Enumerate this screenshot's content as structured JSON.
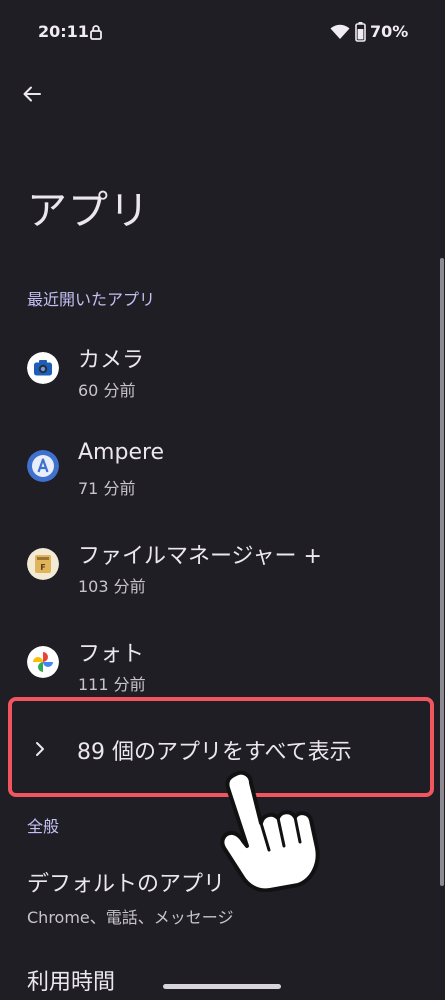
{
  "status_bar": {
    "time": "20:11",
    "battery": "70%"
  },
  "page": {
    "title": "アプリ"
  },
  "recent": {
    "header": "最近開いたアプリ",
    "apps": [
      {
        "name": "カメラ",
        "time": "60 分前",
        "icon": "camera-icon"
      },
      {
        "name": "Ampere",
        "time": "71 分前",
        "icon": "ampere-icon"
      },
      {
        "name": "ファイルマネージャー +",
        "time": "103 分前",
        "icon": "file-manager-icon"
      },
      {
        "name": "フォト",
        "time": "111 分前",
        "icon": "photos-icon"
      }
    ],
    "see_all": "89 個のアプリをすべて表示"
  },
  "general": {
    "header": "全般",
    "default_apps": {
      "title": "デフォルトのアプリ",
      "subtitle": "Chrome、電話、メッセージ"
    },
    "usage": {
      "title": "利用時間"
    }
  },
  "colors": {
    "background": "#1f1e24",
    "accent": "#c4c0f4",
    "highlight": "#f05560"
  }
}
